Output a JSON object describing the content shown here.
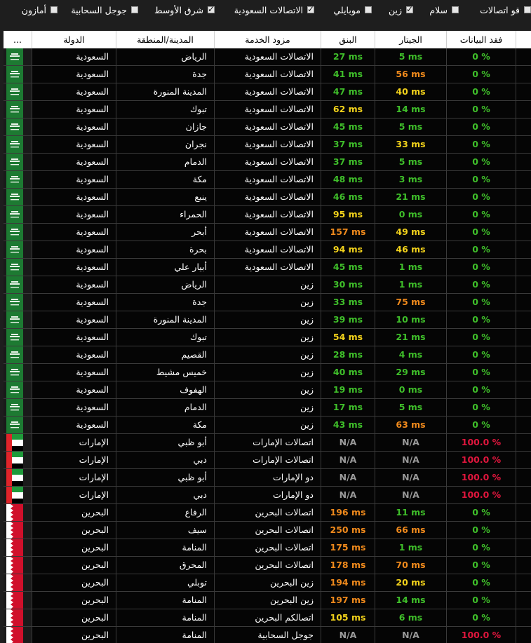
{
  "filters": [
    {
      "label": "قو اتصالات",
      "checked": false
    },
    {
      "label": "سلام",
      "checked": false
    },
    {
      "label": "زين",
      "checked": true
    },
    {
      "label": "موبايلي",
      "checked": false
    },
    {
      "label": "الاتصالات السعودية",
      "checked": true
    },
    {
      "label": "شرق الأوسط",
      "checked": true
    },
    {
      "label": "جوجل السحابية",
      "checked": false
    },
    {
      "label": "أمازون",
      "checked": false
    }
  ],
  "headers": {
    "flag": "...",
    "country": "الدولة",
    "city": "المدينة/المنطقة",
    "provider": "مزود الخدمة",
    "ping": "البنق",
    "jitter": "الجيتار",
    "loss": "فقد البيانات"
  },
  "colors": {
    "green": "#3fbf2a",
    "yellow": "#f2d21b",
    "orange": "#f08a1c",
    "gray": "#9a9a9a",
    "red": "#e0163d"
  },
  "rows": [
    {
      "flag": "sa",
      "country": "السعودية",
      "city": "الرياض",
      "provider": "الاتصالات السعودية",
      "ping": "27 ms",
      "ping_color": "green",
      "jitter": "5 ms",
      "jitter_color": "green",
      "loss": "0 %",
      "loss_color": "green"
    },
    {
      "flag": "sa",
      "country": "السعودية",
      "city": "جدة",
      "provider": "الاتصالات السعودية",
      "ping": "41 ms",
      "ping_color": "green",
      "jitter": "56 ms",
      "jitter_color": "orange",
      "loss": "0 %",
      "loss_color": "green"
    },
    {
      "flag": "sa",
      "country": "السعودية",
      "city": "المدينة المنورة",
      "provider": "الاتصالات السعودية",
      "ping": "47 ms",
      "ping_color": "green",
      "jitter": "40 ms",
      "jitter_color": "yellow",
      "loss": "0 %",
      "loss_color": "green"
    },
    {
      "flag": "sa",
      "country": "السعودية",
      "city": "تبوك",
      "provider": "الاتصالات السعودية",
      "ping": "62 ms",
      "ping_color": "yellow",
      "jitter": "14 ms",
      "jitter_color": "green",
      "loss": "0 %",
      "loss_color": "green"
    },
    {
      "flag": "sa",
      "country": "السعودية",
      "city": "جازان",
      "provider": "الاتصالات السعودية",
      "ping": "45 ms",
      "ping_color": "green",
      "jitter": "5 ms",
      "jitter_color": "green",
      "loss": "0 %",
      "loss_color": "green"
    },
    {
      "flag": "sa",
      "country": "السعودية",
      "city": "نجران",
      "provider": "الاتصالات السعودية",
      "ping": "37 ms",
      "ping_color": "green",
      "jitter": "33 ms",
      "jitter_color": "yellow",
      "loss": "0 %",
      "loss_color": "green"
    },
    {
      "flag": "sa",
      "country": "السعودية",
      "city": "الدمام",
      "provider": "الاتصالات السعودية",
      "ping": "37 ms",
      "ping_color": "green",
      "jitter": "5 ms",
      "jitter_color": "green",
      "loss": "0 %",
      "loss_color": "green"
    },
    {
      "flag": "sa",
      "country": "السعودية",
      "city": "مكة",
      "provider": "الاتصالات السعودية",
      "ping": "48 ms",
      "ping_color": "green",
      "jitter": "3 ms",
      "jitter_color": "green",
      "loss": "0 %",
      "loss_color": "green"
    },
    {
      "flag": "sa",
      "country": "السعودية",
      "city": "ينبع",
      "provider": "الاتصالات السعودية",
      "ping": "46 ms",
      "ping_color": "green",
      "jitter": "21 ms",
      "jitter_color": "green",
      "loss": "0 %",
      "loss_color": "green"
    },
    {
      "flag": "sa",
      "country": "السعودية",
      "city": "الحمراء",
      "provider": "الاتصالات السعودية",
      "ping": "95 ms",
      "ping_color": "yellow",
      "jitter": "0 ms",
      "jitter_color": "green",
      "loss": "0 %",
      "loss_color": "green"
    },
    {
      "flag": "sa",
      "country": "السعودية",
      "city": "أبحر",
      "provider": "الاتصالات السعودية",
      "ping": "157 ms",
      "ping_color": "orange",
      "jitter": "49 ms",
      "jitter_color": "yellow",
      "loss": "0 %",
      "loss_color": "green"
    },
    {
      "flag": "sa",
      "country": "السعودية",
      "city": "بحرة",
      "provider": "الاتصالات السعودية",
      "ping": "94 ms",
      "ping_color": "yellow",
      "jitter": "46 ms",
      "jitter_color": "yellow",
      "loss": "0 %",
      "loss_color": "green"
    },
    {
      "flag": "sa",
      "country": "السعودية",
      "city": "أبيار علي",
      "provider": "الاتصالات السعودية",
      "ping": "45 ms",
      "ping_color": "green",
      "jitter": "1 ms",
      "jitter_color": "green",
      "loss": "0 %",
      "loss_color": "green"
    },
    {
      "flag": "sa",
      "country": "السعودية",
      "city": "الرياض",
      "provider": "زين",
      "ping": "30 ms",
      "ping_color": "green",
      "jitter": "1 ms",
      "jitter_color": "green",
      "loss": "0 %",
      "loss_color": "green"
    },
    {
      "flag": "sa",
      "country": "السعودية",
      "city": "جدة",
      "provider": "زين",
      "ping": "33 ms",
      "ping_color": "green",
      "jitter": "75 ms",
      "jitter_color": "orange",
      "loss": "0 %",
      "loss_color": "green"
    },
    {
      "flag": "sa",
      "country": "السعودية",
      "city": "المدينة المنورة",
      "provider": "زين",
      "ping": "39 ms",
      "ping_color": "green",
      "jitter": "10 ms",
      "jitter_color": "green",
      "loss": "0 %",
      "loss_color": "green"
    },
    {
      "flag": "sa",
      "country": "السعودية",
      "city": "تبوك",
      "provider": "زين",
      "ping": "54 ms",
      "ping_color": "yellow",
      "jitter": "21 ms",
      "jitter_color": "green",
      "loss": "0 %",
      "loss_color": "green"
    },
    {
      "flag": "sa",
      "country": "السعودية",
      "city": "القصيم",
      "provider": "زين",
      "ping": "28 ms",
      "ping_color": "green",
      "jitter": "4 ms",
      "jitter_color": "green",
      "loss": "0 %",
      "loss_color": "green"
    },
    {
      "flag": "sa",
      "country": "السعودية",
      "city": "خميس مشيط",
      "provider": "زين",
      "ping": "40 ms",
      "ping_color": "green",
      "jitter": "29 ms",
      "jitter_color": "green",
      "loss": "0 %",
      "loss_color": "green"
    },
    {
      "flag": "sa",
      "country": "السعودية",
      "city": "الهفوف",
      "provider": "زين",
      "ping": "19 ms",
      "ping_color": "green",
      "jitter": "0 ms",
      "jitter_color": "green",
      "loss": "0 %",
      "loss_color": "green"
    },
    {
      "flag": "sa",
      "country": "السعودية",
      "city": "الدمام",
      "provider": "زين",
      "ping": "17 ms",
      "ping_color": "green",
      "jitter": "5 ms",
      "jitter_color": "green",
      "loss": "0 %",
      "loss_color": "green"
    },
    {
      "flag": "sa",
      "country": "السعودية",
      "city": "مكة",
      "provider": "زين",
      "ping": "43 ms",
      "ping_color": "green",
      "jitter": "63 ms",
      "jitter_color": "orange",
      "loss": "0 %",
      "loss_color": "green"
    },
    {
      "flag": "ae",
      "country": "الإمارات",
      "city": "أبو ظبي",
      "provider": "اتصالات الإمارات",
      "ping": "N/A",
      "ping_color": "gray",
      "jitter": "N/A",
      "jitter_color": "gray",
      "loss": "100.0 %",
      "loss_color": "red"
    },
    {
      "flag": "ae",
      "country": "الإمارات",
      "city": "دبي",
      "provider": "اتصالات الإمارات",
      "ping": "N/A",
      "ping_color": "gray",
      "jitter": "N/A",
      "jitter_color": "gray",
      "loss": "100.0 %",
      "loss_color": "red"
    },
    {
      "flag": "ae",
      "country": "الإمارات",
      "city": "أبو ظبي",
      "provider": "دو الإمارات",
      "ping": "N/A",
      "ping_color": "gray",
      "jitter": "N/A",
      "jitter_color": "gray",
      "loss": "100.0 %",
      "loss_color": "red"
    },
    {
      "flag": "ae",
      "country": "الإمارات",
      "city": "دبي",
      "provider": "دو الإمارات",
      "ping": "N/A",
      "ping_color": "gray",
      "jitter": "N/A",
      "jitter_color": "gray",
      "loss": "100.0 %",
      "loss_color": "red"
    },
    {
      "flag": "bh",
      "country": "البحرين",
      "city": "الرفاع",
      "provider": "اتصالات البحرين",
      "ping": "196 ms",
      "ping_color": "orange",
      "jitter": "11 ms",
      "jitter_color": "green",
      "loss": "0 %",
      "loss_color": "green"
    },
    {
      "flag": "bh",
      "country": "البحرين",
      "city": "سيف",
      "provider": "اتصالات البحرين",
      "ping": "250 ms",
      "ping_color": "orange",
      "jitter": "66 ms",
      "jitter_color": "orange",
      "loss": "0 %",
      "loss_color": "green"
    },
    {
      "flag": "bh",
      "country": "البحرين",
      "city": "المنامة",
      "provider": "اتصالات البحرين",
      "ping": "175 ms",
      "ping_color": "orange",
      "jitter": "1 ms",
      "jitter_color": "green",
      "loss": "0 %",
      "loss_color": "green"
    },
    {
      "flag": "bh",
      "country": "البحرين",
      "city": "المحرق",
      "provider": "اتصالات البحرين",
      "ping": "178 ms",
      "ping_color": "orange",
      "jitter": "70 ms",
      "jitter_color": "orange",
      "loss": "0 %",
      "loss_color": "green"
    },
    {
      "flag": "bh",
      "country": "البحرين",
      "city": "توبلي",
      "provider": "زين البحرين",
      "ping": "194 ms",
      "ping_color": "orange",
      "jitter": "20 ms",
      "jitter_color": "yellow",
      "loss": "0 %",
      "loss_color": "green"
    },
    {
      "flag": "bh",
      "country": "البحرين",
      "city": "المنامة",
      "provider": "زين البحرين",
      "ping": "197 ms",
      "ping_color": "orange",
      "jitter": "14 ms",
      "jitter_color": "green",
      "loss": "0 %",
      "loss_color": "green"
    },
    {
      "flag": "bh",
      "country": "البحرين",
      "city": "المنامة",
      "provider": "اتصالكم البحرين",
      "ping": "105 ms",
      "ping_color": "yellow",
      "jitter": "6 ms",
      "jitter_color": "green",
      "loss": "0 %",
      "loss_color": "green"
    },
    {
      "flag": "bh",
      "country": "البحرين",
      "city": "المنامة",
      "provider": "جوجل السحابية",
      "ping": "N/A",
      "ping_color": "gray",
      "jitter": "N/A",
      "jitter_color": "gray",
      "loss": "100.0 %",
      "loss_color": "red"
    }
  ]
}
